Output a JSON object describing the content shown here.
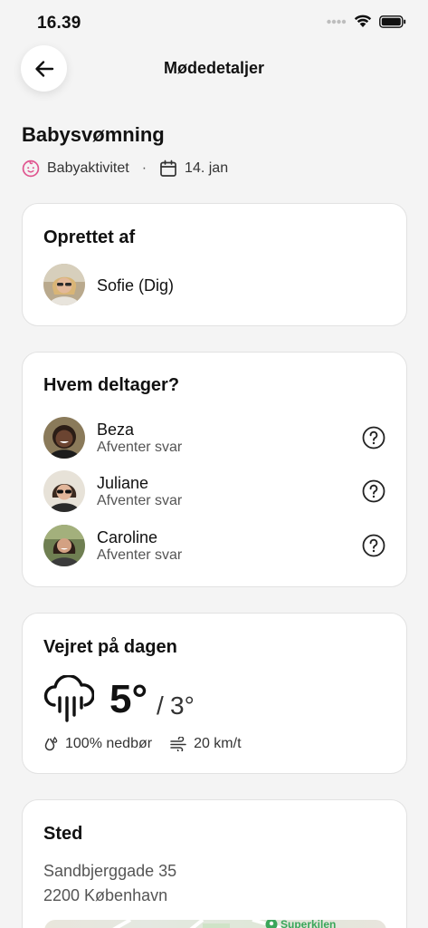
{
  "status_bar": {
    "time": "16.39"
  },
  "nav": {
    "title": "Mødedetaljer"
  },
  "event": {
    "title": "Babysvømning",
    "category": "Babyaktivitet",
    "separator": "·",
    "date": "14. jan"
  },
  "creator_card": {
    "title": "Oprettet af",
    "name": "Sofie (Dig)"
  },
  "participants_card": {
    "title": "Hvem deltager?",
    "people": [
      {
        "name": "Beza",
        "status": "Afventer svar"
      },
      {
        "name": "Juliane",
        "status": "Afventer svar"
      },
      {
        "name": "Caroline",
        "status": "Afventer svar"
      }
    ]
  },
  "weather_card": {
    "title": "Vejret på dagen",
    "temp_high": "5°",
    "temp_sep": "/",
    "temp_low": "3°",
    "precipitation": "100% nedbør",
    "wind": "20 km/t"
  },
  "location_card": {
    "title": "Sted",
    "address_line1": "Sandbjerggade 35",
    "address_line2": "2200 København",
    "map_label": "Superkilen"
  },
  "colors": {
    "accent_pink": "#e0558f",
    "map_green": "#3aa65a"
  }
}
